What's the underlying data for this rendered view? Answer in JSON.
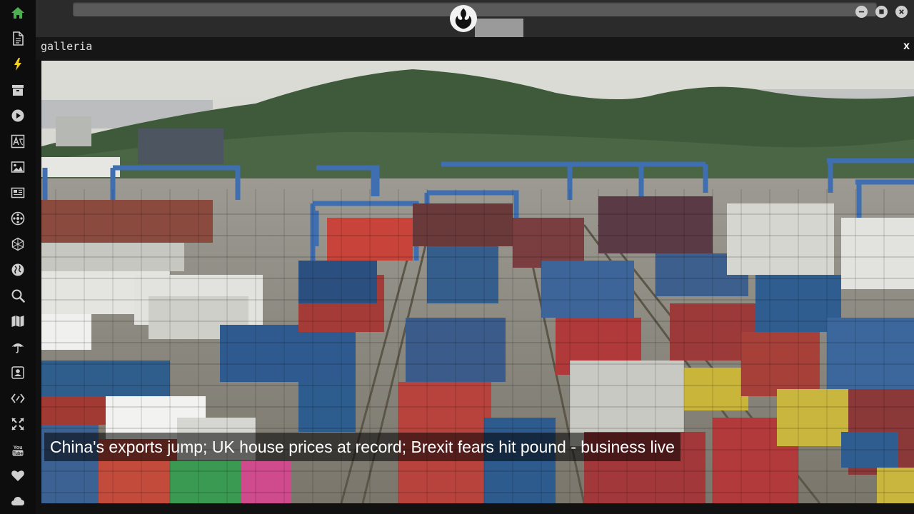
{
  "sidebar": {
    "items": [
      {
        "icon": "home-icon",
        "color": "#4caf50"
      },
      {
        "icon": "document-icon",
        "color": "#cfcfcf"
      },
      {
        "icon": "lightning-icon",
        "color": "#f5d020"
      },
      {
        "icon": "archive-icon",
        "color": "#cfcfcf"
      },
      {
        "icon": "play-circle-icon",
        "color": "#cfcfcf"
      },
      {
        "icon": "translate-icon",
        "color": "#cfcfcf"
      },
      {
        "icon": "image-icon",
        "color": "#cfcfcf"
      },
      {
        "icon": "newspaper-icon",
        "color": "#cfcfcf"
      },
      {
        "icon": "film-reel-icon",
        "color": "#cfcfcf"
      },
      {
        "icon": "hexagon-network-icon",
        "color": "#cfcfcf"
      },
      {
        "icon": "globe-icon",
        "color": "#cfcfcf"
      },
      {
        "icon": "search-icon",
        "color": "#cfcfcf"
      },
      {
        "icon": "map-icon",
        "color": "#cfcfcf"
      },
      {
        "icon": "umbrella-icon",
        "color": "#cfcfcf"
      },
      {
        "icon": "contact-card-icon",
        "color": "#cfcfcf"
      },
      {
        "icon": "code-icon",
        "color": "#cfcfcf"
      },
      {
        "icon": "expand-arrows-icon",
        "color": "#cfcfcf"
      },
      {
        "icon": "youtube-icon",
        "color": "#cfcfcf"
      },
      {
        "icon": "heart-icon",
        "color": "#cfcfcf"
      },
      {
        "icon": "cloud-icon",
        "color": "#cfcfcf"
      }
    ]
  },
  "window": {
    "buttons": [
      "minimize-icon",
      "maximize-icon",
      "close-icon"
    ]
  },
  "panel": {
    "title": "galleria",
    "close_label": "x"
  },
  "gallery": {
    "caption": "China's exports jump; UK house prices at record; Brexit fears hit pound - business live"
  }
}
